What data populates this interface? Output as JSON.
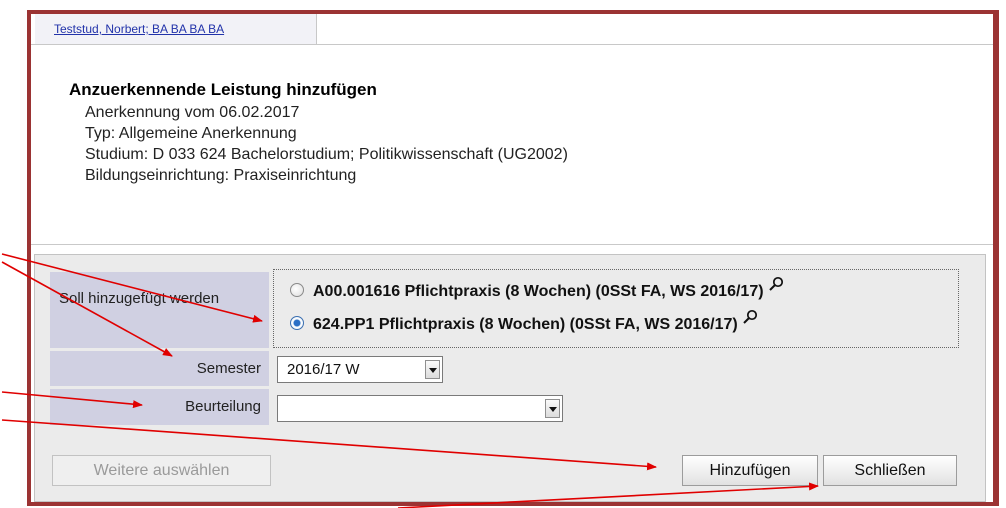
{
  "tab": {
    "label": "Teststud, Norbert; BA BA BA BA"
  },
  "info": {
    "title": "Anzuerkennende Leistung hinzufügen",
    "recognition_date": "Anerkennung vom 06.02.2017",
    "type": "Typ: Allgemeine Anerkennung",
    "study": "Studium: D 033 624 Bachelorstudium; Politikwissenschaft (UG2002)",
    "institution": "Bildungseinrichtung: Praxiseinrichtung"
  },
  "form": {
    "soll_label": "Soll hinzugefügt werden",
    "options": [
      {
        "label": "A00.001616 Pflichtpraxis (8 Wochen) (0SSt FA, WS 2016/17)",
        "selected": false
      },
      {
        "label": "624.PP1 Pflichtpraxis (8 Wochen) (0SSt FA, WS 2016/17)",
        "selected": true
      }
    ],
    "semester_label": "Semester",
    "semester_value": "2016/17 W",
    "beurteilung_label": "Beurteilung",
    "beurteilung_value": ""
  },
  "buttons": {
    "more": "Weitere auswählen",
    "add": "Hinzufügen",
    "close": "Schließen"
  },
  "colors": {
    "frame": "#9b3333",
    "label_background": "#d0d0e2",
    "annotation_arrow": "#e00000",
    "link": "#2233aa"
  }
}
